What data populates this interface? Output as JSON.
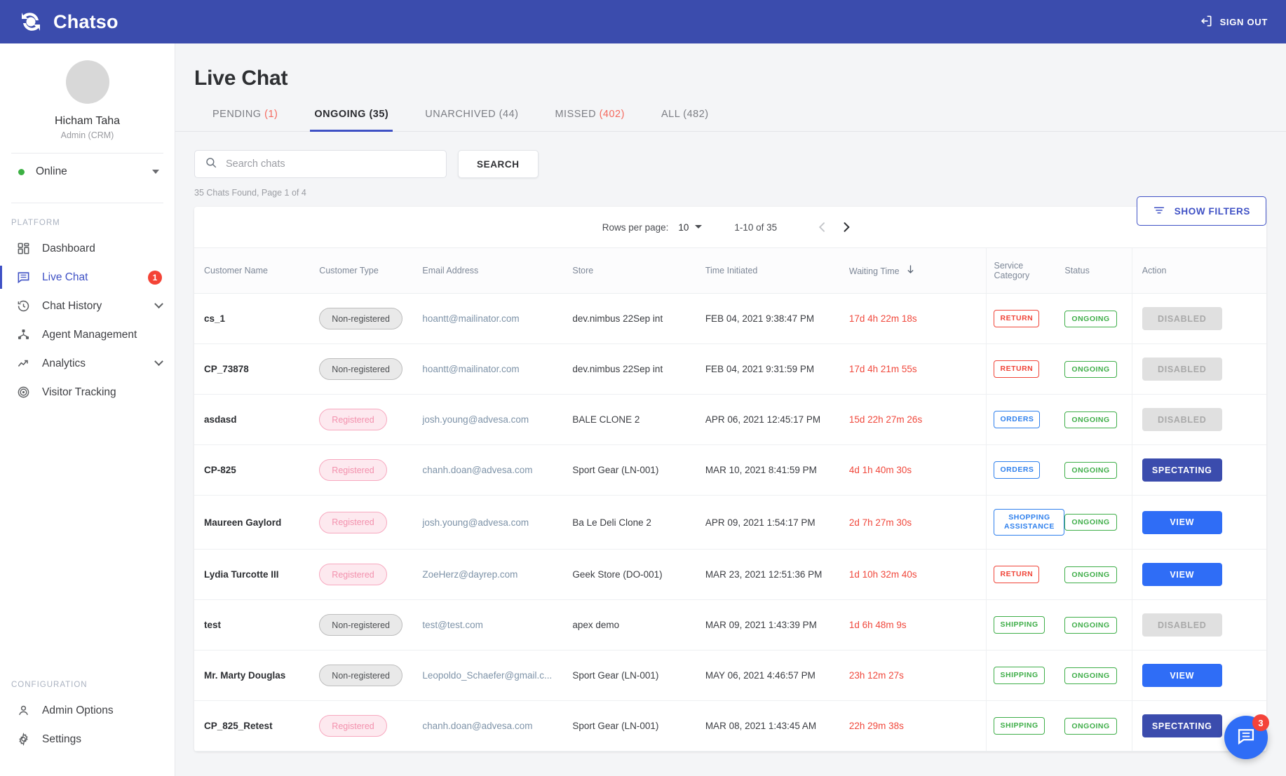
{
  "topbar": {
    "brand": "Chatso",
    "signout_label": "SIGN OUT"
  },
  "sidebar": {
    "profile": {
      "name": "Hicham Taha",
      "role": "Admin (CRM)"
    },
    "status": {
      "label": "Online",
      "color": "#3cb043"
    },
    "platform_label": "PLATFORM",
    "configuration_label": "CONFIGURATION",
    "platform_items": [
      {
        "label": "Dashboard",
        "icon": "dashboard-grid-icon"
      },
      {
        "label": "Live Chat",
        "icon": "chat-box-icon",
        "badge": "1"
      },
      {
        "label": "Chat History",
        "icon": "history-clock-icon",
        "chevron": true
      },
      {
        "label": "Agent Management",
        "icon": "agent-network-icon"
      },
      {
        "label": "Analytics",
        "icon": "trend-up-icon",
        "chevron": true
      },
      {
        "label": "Visitor Tracking",
        "icon": "radar-target-icon"
      }
    ],
    "config_items": [
      {
        "label": "Admin Options",
        "icon": "person-icon"
      },
      {
        "label": "Settings",
        "icon": "gear-icon"
      }
    ]
  },
  "main": {
    "page_title": "Live Chat",
    "tabs": [
      {
        "label": "PENDING",
        "count": "(1)",
        "count_red": true,
        "active": false
      },
      {
        "label": "ONGOING",
        "count": "(35)",
        "count_red": false,
        "active": true
      },
      {
        "label": "UNARCHIVED",
        "count": "(44)",
        "count_red": false,
        "active": false
      },
      {
        "label": "MISSED",
        "count": "(402)",
        "count_red": true,
        "active": false
      },
      {
        "label": "ALL",
        "count": "(482)",
        "count_red": false,
        "active": false
      }
    ],
    "search": {
      "placeholder": "Search chats",
      "value": "",
      "button_label": "SEARCH"
    },
    "filters_button": "SHOW FILTERS",
    "results_summary": "35 Chats Found, Page 1 of 4",
    "pagination": {
      "rows_per_page_label": "Rows per page:",
      "rows_per_page_value": "10",
      "range_label": "1-10 of 35"
    },
    "columns": [
      "Customer Name",
      "Customer Type",
      "Email Address",
      "Store",
      "Time Initiated",
      "Waiting Time",
      "Service Category",
      "Status",
      "Action"
    ],
    "sort_column": "Waiting Time",
    "sort_direction": "desc",
    "rows": [
      {
        "name": "cs_1",
        "type": "Non-registered",
        "registered": false,
        "email": "hoantt@mailinator.com",
        "store": "dev.nimbus 22Sep int",
        "time": "FEB 04, 2021 9:38:47 PM",
        "wait": "17d 4h 22m 18s",
        "service": "RETURN",
        "service_color": "red",
        "status": "ONGOING",
        "action": "DISABLED",
        "action_style": "disabled"
      },
      {
        "name": "CP_73878",
        "type": "Non-registered",
        "registered": false,
        "email": "hoantt@mailinator.com",
        "store": "dev.nimbus 22Sep int",
        "time": "FEB 04, 2021 9:31:59 PM",
        "wait": "17d 4h 21m 55s",
        "service": "RETURN",
        "service_color": "red",
        "status": "ONGOING",
        "action": "DISABLED",
        "action_style": "disabled"
      },
      {
        "name": "asdasd",
        "type": "Registered",
        "registered": true,
        "email": "josh.young@advesa.com",
        "store": "BALE CLONE 2",
        "time": "APR 06, 2021 12:45:17 PM",
        "wait": "15d 22h 27m 26s",
        "service": "ORDERS",
        "service_color": "blue",
        "status": "ONGOING",
        "action": "DISABLED",
        "action_style": "disabled"
      },
      {
        "name": "CP-825",
        "type": "Registered",
        "registered": true,
        "email": "chanh.doan@advesa.com",
        "store": "Sport Gear (LN-001)",
        "time": "MAR 10, 2021 8:41:59 PM",
        "wait": "4d 1h 40m 30s",
        "service": "ORDERS",
        "service_color": "blue",
        "status": "ONGOING",
        "action": "SPECTATING",
        "action_style": "spect"
      },
      {
        "name": "Maureen Gaylord",
        "type": "Registered",
        "registered": true,
        "email": "josh.young@advesa.com",
        "store": "Ba Le Deli Clone 2",
        "time": "APR 09, 2021 1:54:17 PM",
        "wait": "2d 7h 27m 30s",
        "service": "SHOPPING ASSISTANCE",
        "service_color": "blue",
        "status": "ONGOING",
        "action": "VIEW",
        "action_style": "view"
      },
      {
        "name": "Lydia Turcotte III",
        "type": "Registered",
        "registered": true,
        "email": "ZoeHerz@dayrep.com",
        "store": "Geek Store (DO-001)",
        "time": "MAR 23, 2021 12:51:36 PM",
        "wait": "1d 10h 32m 40s",
        "service": "RETURN",
        "service_color": "red",
        "status": "ONGOING",
        "action": "VIEW",
        "action_style": "view"
      },
      {
        "name": "test",
        "type": "Non-registered",
        "registered": false,
        "email": "test@test.com",
        "store": "apex demo",
        "time": "MAR 09, 2021 1:43:39 PM",
        "wait": "1d 6h 48m 9s",
        "service": "SHIPPING",
        "service_color": "green",
        "status": "ONGOING",
        "action": "DISABLED",
        "action_style": "disabled"
      },
      {
        "name": "Mr. Marty Douglas",
        "type": "Non-registered",
        "registered": false,
        "email": "Leopoldo_Schaefer@gmail.c...",
        "store": "Sport Gear (LN-001)",
        "time": "MAY 06, 2021 4:46:57 PM",
        "wait": "23h 12m 27s",
        "service": "SHIPPING",
        "service_color": "green",
        "status": "ONGOING",
        "action": "VIEW",
        "action_style": "view"
      },
      {
        "name": "CP_825_Retest",
        "type": "Registered",
        "registered": true,
        "email": "chanh.doan@advesa.com",
        "store": "Sport Gear (LN-001)",
        "time": "MAR 08, 2021 1:43:45 AM",
        "wait": "22h 29m 38s",
        "service": "SHIPPING",
        "service_color": "green",
        "status": "ONGOING",
        "action": "SPECTATING",
        "action_style": "spect"
      }
    ]
  },
  "chat_widget": {
    "badge": "3",
    "icon": "chat-bubble-icon"
  },
  "colors": {
    "brand": "#3b4cad",
    "accent_blue": "#2f6df6",
    "danger_red": "#f0483c",
    "success_green": "#3fae49",
    "pink": "#f391ad"
  }
}
